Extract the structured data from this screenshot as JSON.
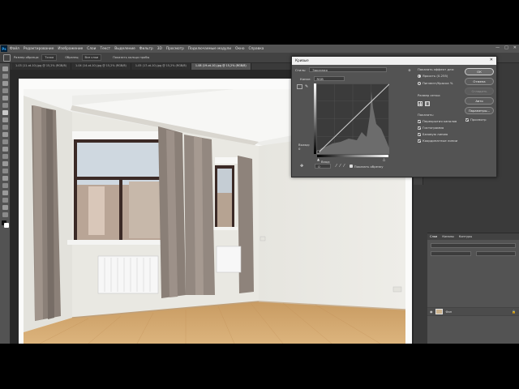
{
  "menu": {
    "items": [
      "Файл",
      "Редактирование",
      "Изображение",
      "Слои",
      "Текст",
      "Выделение",
      "Фильтр",
      "3D",
      "Просмотр",
      "Подключаемые модули",
      "Окно",
      "Справка"
    ]
  },
  "optbar": {
    "sample_size_label": "Размер образца:",
    "sample_size_value": "Точка",
    "sample_label": "Образец:",
    "sample_value": "Все слои",
    "show_ring_label": "Показать кольцо пробы"
  },
  "tabs": [
    "1-03 (11-ot-10).jpg @ 15,2% (RGB/8)",
    "1-04 (14-ot-10).jpg @ 15,2% (RGB/8)",
    "1-05 (17-ot-10).jpg @ 15,2% (RGB/8)",
    "1-08 (19-ot-10).jpg @ 15,2% (RGB/8)"
  ],
  "curves": {
    "title": "Кривые",
    "preset_label": "Стиль:",
    "preset_value": "Заказная",
    "channel_label": "Канал:",
    "channel_value": "RGB",
    "output_label": "Выход:",
    "output_value": "0",
    "input_label": "Вход:",
    "input_value": "0",
    "show_clipping_label": "Показать обрезку",
    "display_amount_heading": "Показать эффект для:",
    "light_option": "Яркость (0-255)",
    "pigment_option": "Пигмент/Краска %",
    "grid_size_heading": "Размер сетки:",
    "show_heading": "Показать:",
    "show_options": [
      "Перекрытия каналов",
      "Гистограмма",
      "Базовую линию",
      "Координатные линии"
    ],
    "ok_label": "ОК",
    "cancel_label": "Отмена",
    "smooth_label": "Сгладить",
    "auto_label": "Авто",
    "options_label": "Параметры...",
    "preview_label": "Просмотр"
  },
  "layers": {
    "tabs": [
      "Слои",
      "Каналы",
      "Контуры"
    ],
    "layer_name": "Фон"
  },
  "colors": {
    "ui_dark": "#535353",
    "canvas_bg": "#282828",
    "accent": "#31a8ff"
  }
}
